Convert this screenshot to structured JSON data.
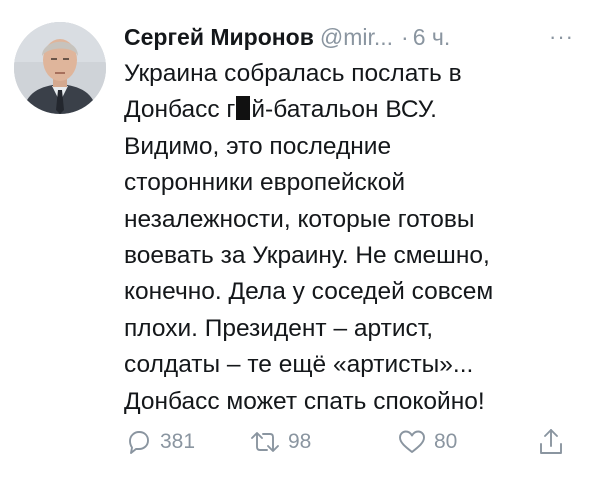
{
  "tweet": {
    "author": {
      "display_name": "Сергей Миронов",
      "handle": "@mir...",
      "separator": "·",
      "time": "6 ч."
    },
    "more_label": "···",
    "text_lines": {
      "l1": "Украина собралась послать в",
      "l2a": "Донбасс г",
      "l2b": "й-батальон ВСУ.",
      "l3": "Видимо, это последние",
      "l4": "сторонники европейской",
      "l5": "незалежности, которые готовы",
      "l6": "воевать за Украину. Не смешно,",
      "l7": "конечно. Дела у соседей совсем",
      "l8": "плохи. Президент – артист,",
      "l9": "солдаты – те ещё «артисты»...",
      "l10": "Донбасс может спать спокойно!"
    },
    "actions": {
      "reply_count": "381",
      "retweet_count": "98",
      "like_count": "80"
    },
    "icons": {
      "reply": "reply-icon",
      "retweet": "retweet-icon",
      "like": "heart-icon",
      "share": "share-icon",
      "more": "more-icon"
    },
    "colors": {
      "text": "#14171a",
      "secondary": "#8a95a0",
      "background": "#ffffff"
    }
  }
}
